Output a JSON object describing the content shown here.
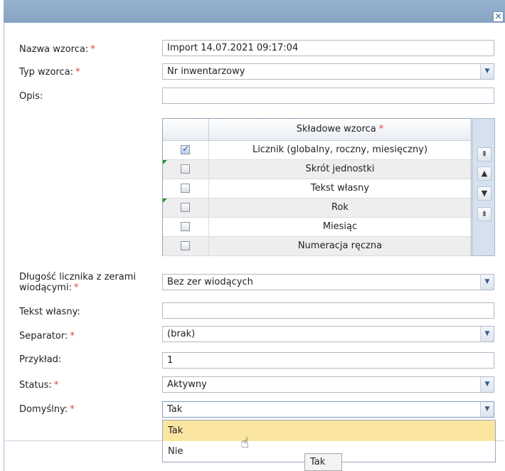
{
  "window": {
    "close_glyph": "✕"
  },
  "form": {
    "required_mark": "*",
    "name_label": "Nazwa wzorca:",
    "name_value": "Import 14.07.2021 09:17:04",
    "type_label": "Typ wzorca:",
    "type_value": "Nr inwentarzowy",
    "desc_label": "Opis:",
    "desc_value": "",
    "counter_len_label_1": "Długość licznika z zerami",
    "counter_len_label_2": "wiodącymi:",
    "counter_len_value": "Bez zer wiodących",
    "own_text_label": "Tekst własny:",
    "own_text_value": "",
    "separator_label": "Separator:",
    "separator_value": "(brak)",
    "example_label": "Przykład:",
    "example_value": "1",
    "status_label": "Status:",
    "status_value": "Aktywny",
    "default_label": "Domyślny:",
    "default_value": "Tak"
  },
  "components": {
    "header": "Składowe wzorca",
    "rows": [
      {
        "name": "Licznik (globalny, roczny, miesięczny)",
        "checked": true,
        "marker": false
      },
      {
        "name": "Skrót jednostki",
        "checked": false,
        "marker": true
      },
      {
        "name": "Tekst własny",
        "checked": false,
        "marker": false
      },
      {
        "name": "Rok",
        "checked": false,
        "marker": true
      },
      {
        "name": "Miesiąc",
        "checked": false,
        "marker": false
      },
      {
        "name": "Numeracja ręczna",
        "checked": false,
        "marker": false
      }
    ]
  },
  "icons": {
    "move_top": "double-arrow-up-icon",
    "move_up": "arrow-up-icon",
    "move_down": "arrow-down-icon",
    "move_bottom": "double-arrow-down-icon",
    "dropdown": "chevron-down-icon",
    "cursor": "hand-pointer-icon"
  },
  "dropdown": {
    "options": [
      "Tak",
      "Nie"
    ],
    "hovered_index": 0
  },
  "tooltip": {
    "text": "Tak"
  },
  "colors": {
    "titlebar": "#8fabca",
    "required": "#e23a3a",
    "hover": "#fbe6a1",
    "panel": "#d6e1ef"
  }
}
